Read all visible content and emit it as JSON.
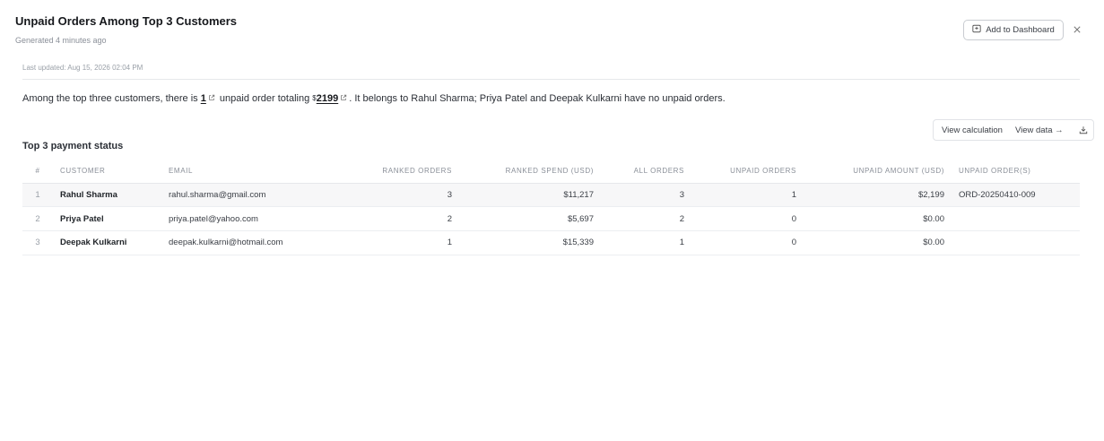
{
  "header": {
    "title": "Unpaid Orders Among Top 3 Customers",
    "generated": "Generated 4 minutes ago",
    "add_to_dashboard": "Add to Dashboard"
  },
  "meta": {
    "last_updated": "Last updated: Aug 15, 2026 02:04 PM"
  },
  "summary": {
    "part1": "Among the top three customers, there is ",
    "count": "1",
    "part2": " unpaid order totaling ",
    "currency": "$",
    "amount": "2199",
    "part3": ". It belongs to Rahul Sharma; Priya Patel and Deepak Kulkarni have no unpaid orders."
  },
  "table_section": {
    "title": "Top 3 payment status",
    "view_calculation": "View calculation",
    "view_data": "View data →"
  },
  "table": {
    "columns": [
      "#",
      "CUSTOMER",
      "EMAIL",
      "RANKED ORDERS",
      "RANKED SPEND (USD)",
      "ALL ORDERS",
      "UNPAID ORDERS",
      "UNPAID AMOUNT (USD)",
      "UNPAID ORDER(S)"
    ],
    "rows": [
      [
        "1",
        "Rahul Sharma",
        "rahul.sharma@gmail.com",
        "3",
        "$11,217",
        "3",
        "1",
        "$2,199",
        "ORD-20250410-009"
      ],
      [
        "2",
        "Priya Patel",
        "priya.patel@yahoo.com",
        "2",
        "$5,697",
        "2",
        "0",
        "$0.00",
        ""
      ],
      [
        "3",
        "Deepak Kulkarni",
        "deepak.kulkarni@hotmail.com",
        "1",
        "$15,339",
        "1",
        "0",
        "$0.00",
        ""
      ]
    ]
  },
  "icons": {
    "dashboard": "dashboard-icon",
    "close": "close-icon",
    "external_link": "external-link-icon",
    "download": "download-icon"
  }
}
